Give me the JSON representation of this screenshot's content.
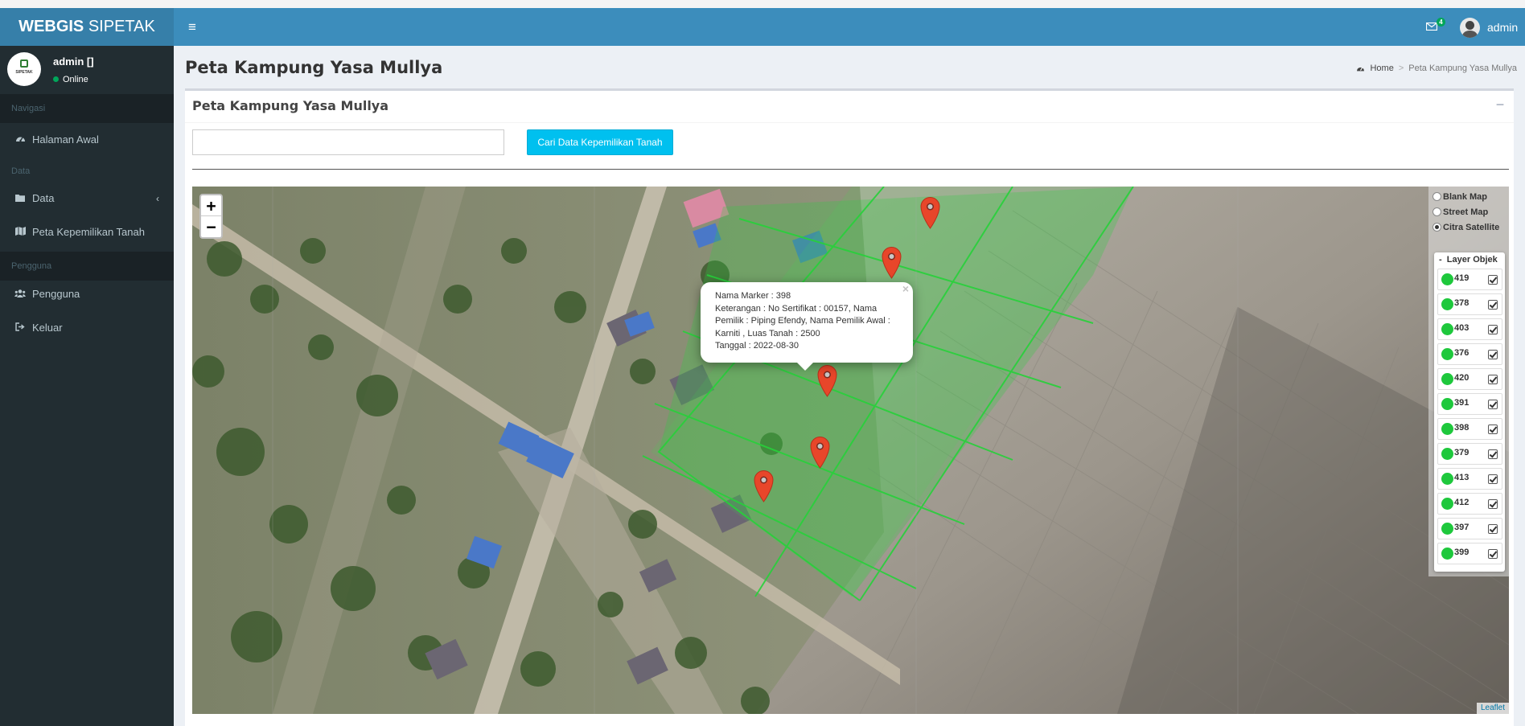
{
  "app": {
    "logo_bold": "WEBGIS",
    "logo_rest": " SIPETAK",
    "messages_count": "4",
    "user_name": "admin"
  },
  "sidebar": {
    "user_name": "admin []",
    "user_status": "Online",
    "avatar_text": "SIPETAK",
    "sections": [
      {
        "label": "Navigasi"
      },
      {
        "label": "Data"
      },
      {
        "label": "Pengguna"
      }
    ],
    "items": [
      {
        "label": "Halaman Awal",
        "icon": "dashboard-icon"
      },
      {
        "label": "Data",
        "icon": "folder-icon"
      },
      {
        "label": "Peta Kepemilikan Tanah",
        "icon": "map-icon"
      },
      {
        "label": "Pengguna",
        "icon": "users-icon"
      },
      {
        "label": "Keluar",
        "icon": "sign-out-icon"
      }
    ]
  },
  "page": {
    "title": "Peta Kampung Yasa Mullya",
    "breadcrumb": {
      "home": "Home",
      "current": "Peta Kampung Yasa Mullya"
    },
    "box_title": "Peta Kampung Yasa Mullya",
    "search_value": "",
    "search_button": "Cari Data Kepemilikan Tanah"
  },
  "map": {
    "zoom_in": "+",
    "zoom_out": "−",
    "popup": {
      "line1": "Nama Marker : 398",
      "line2": "Keterangan : No Sertifikat : 00157, Nama Pemilik : Piping Efendy, Nama Pemilik Awal : Karniti , Luas Tanah : 2500",
      "line3": "Tanggal : 2022-08-30"
    },
    "basemaps": [
      {
        "label": "Blank Map",
        "selected": false
      },
      {
        "label": "Street Map",
        "selected": false
      },
      {
        "label": "Citra Satellite",
        "selected": true
      }
    ],
    "layer_title": "Layer Objek",
    "layer_collapse": "-",
    "layers": [
      "419",
      "378",
      "403",
      "376",
      "420",
      "391",
      "398",
      "379",
      "413",
      "412",
      "397",
      "399"
    ],
    "layer_color": "#1ec83c",
    "marker_color": "#e8462a",
    "attribution": "Leaflet"
  },
  "colors": {
    "header": "#3c8dbc",
    "logo_bg": "#367fa9",
    "sidebar": "#222d32",
    "button": "#00c0ef"
  }
}
